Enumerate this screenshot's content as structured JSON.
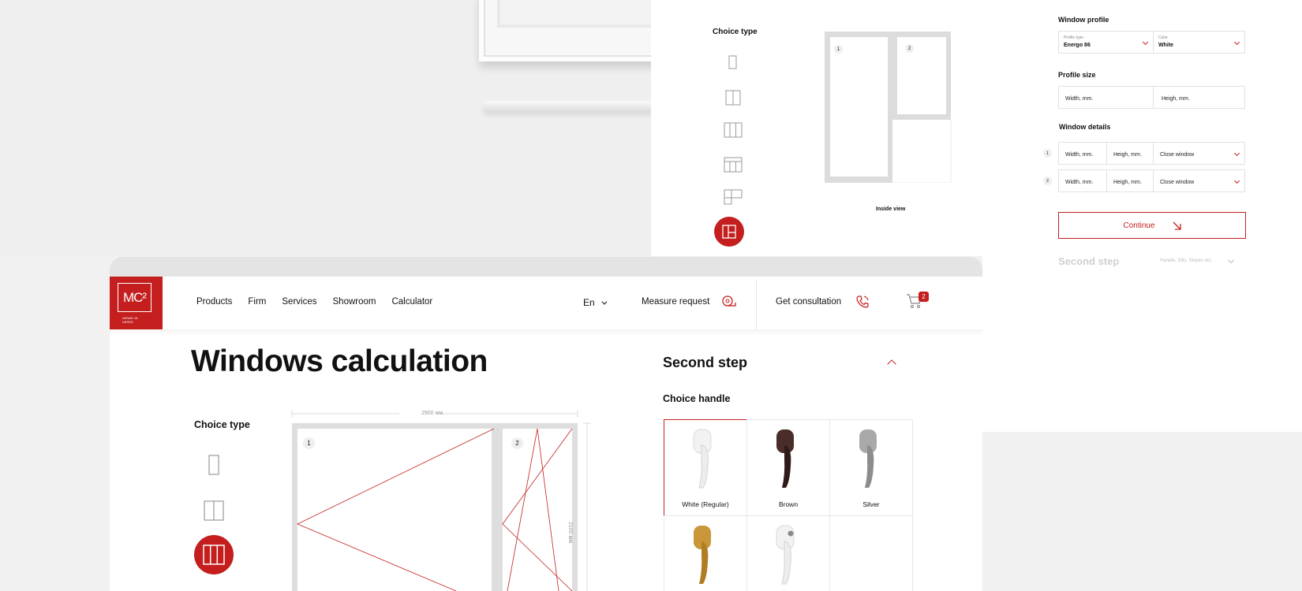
{
  "colors": {
    "accent": "#c41e1e",
    "muted": "#cfcfcf"
  },
  "preview": {
    "choice_type": "Choice type",
    "inside_view": "Inside view",
    "sash_numbers": [
      "1",
      "2"
    ]
  },
  "panel": {
    "window_profile_label": "Window profile",
    "profile_type_small": "Profile type",
    "profile_type_value": "Energo 86",
    "color_small": "Color",
    "color_value": "White",
    "profile_size_label": "Profile size",
    "width_placeholder": "Width, mm.",
    "height_placeholder": "Heigh, mm.",
    "window_details_label": "Window details",
    "rows": [
      {
        "num": "1",
        "width": "Width, mm.",
        "height": "Heigh, mm.",
        "option": "Close window"
      },
      {
        "num": "2",
        "width": "Width, mm.",
        "height": "Heigh, mm.",
        "option": "Close window"
      }
    ],
    "continue_label": "Continue",
    "second_step": "Second step",
    "second_step_hint": "Handle, Sills, Slopes etc."
  },
  "header": {
    "logo_text": "MC²",
    "logo_sub": "AKNAD JA\nUKSED",
    "nav": [
      "Products",
      "Firm",
      "Services",
      "Showroom",
      "Calculator"
    ],
    "language": "En",
    "measure_request": "Measure request",
    "get_consultation": "Get consultation",
    "cart_count": "2"
  },
  "main": {
    "title": "Windows calculation",
    "choice_type": "Choice type",
    "width_dim": "2900 мм",
    "height_dim": "2100 мм",
    "sash_numbers": [
      "1",
      "2"
    ],
    "second_step": "Second step",
    "choice_handle": "Choice handle",
    "handles": [
      {
        "label": "White (Regular)",
        "color": "#f4f4f4",
        "selected": true
      },
      {
        "label": "Brown",
        "color": "#3a2220",
        "selected": false
      },
      {
        "label": "Silver",
        "color": "#9a9a9a",
        "selected": false
      },
      {
        "label": "",
        "color": "#c08a2c",
        "selected": false
      },
      {
        "label": "",
        "color": "#f2f2f2",
        "selected": false
      }
    ]
  }
}
